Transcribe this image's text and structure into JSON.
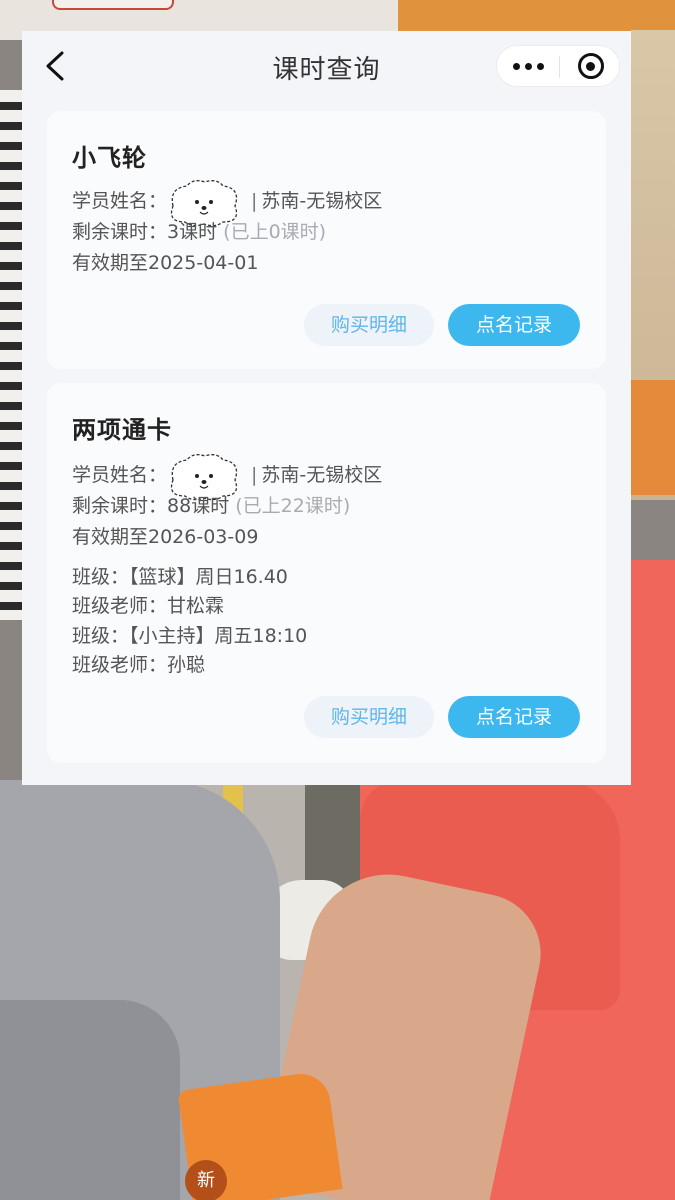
{
  "nav": {
    "title": "课时查询"
  },
  "cards": [
    {
      "title": "小飞轮",
      "student_label": "学员姓名：",
      "campus": "苏南-无锡校区",
      "remaining_label": "剩余课时：",
      "remaining": "3课时",
      "used": "(已上0课时)",
      "valid_until": "有效期至2025-04-01",
      "buttons": {
        "purchase": "购买明细",
        "attendance": "点名记录"
      }
    },
    {
      "title": "两项通卡",
      "student_label": "学员姓名：",
      "campus": "苏南-无锡校区",
      "remaining_label": "剩余课时：",
      "remaining": "88课时",
      "used": "(已上22课时)",
      "valid_until": "有效期至2026-03-09",
      "classes": [
        "班级：【篮球】周日16.40",
        "班级老师：甘松霖",
        "班级：【小主持】周五18:10",
        "班级老师：孙聪"
      ],
      "buttons": {
        "purchase": "购买明细",
        "attendance": "点名记录"
      }
    }
  ],
  "background": {
    "bag_text": "新"
  },
  "colors": {
    "accent": "#3cb8ee",
    "accent_light": "#5fb5ec",
    "muted": "#a9abb1"
  }
}
